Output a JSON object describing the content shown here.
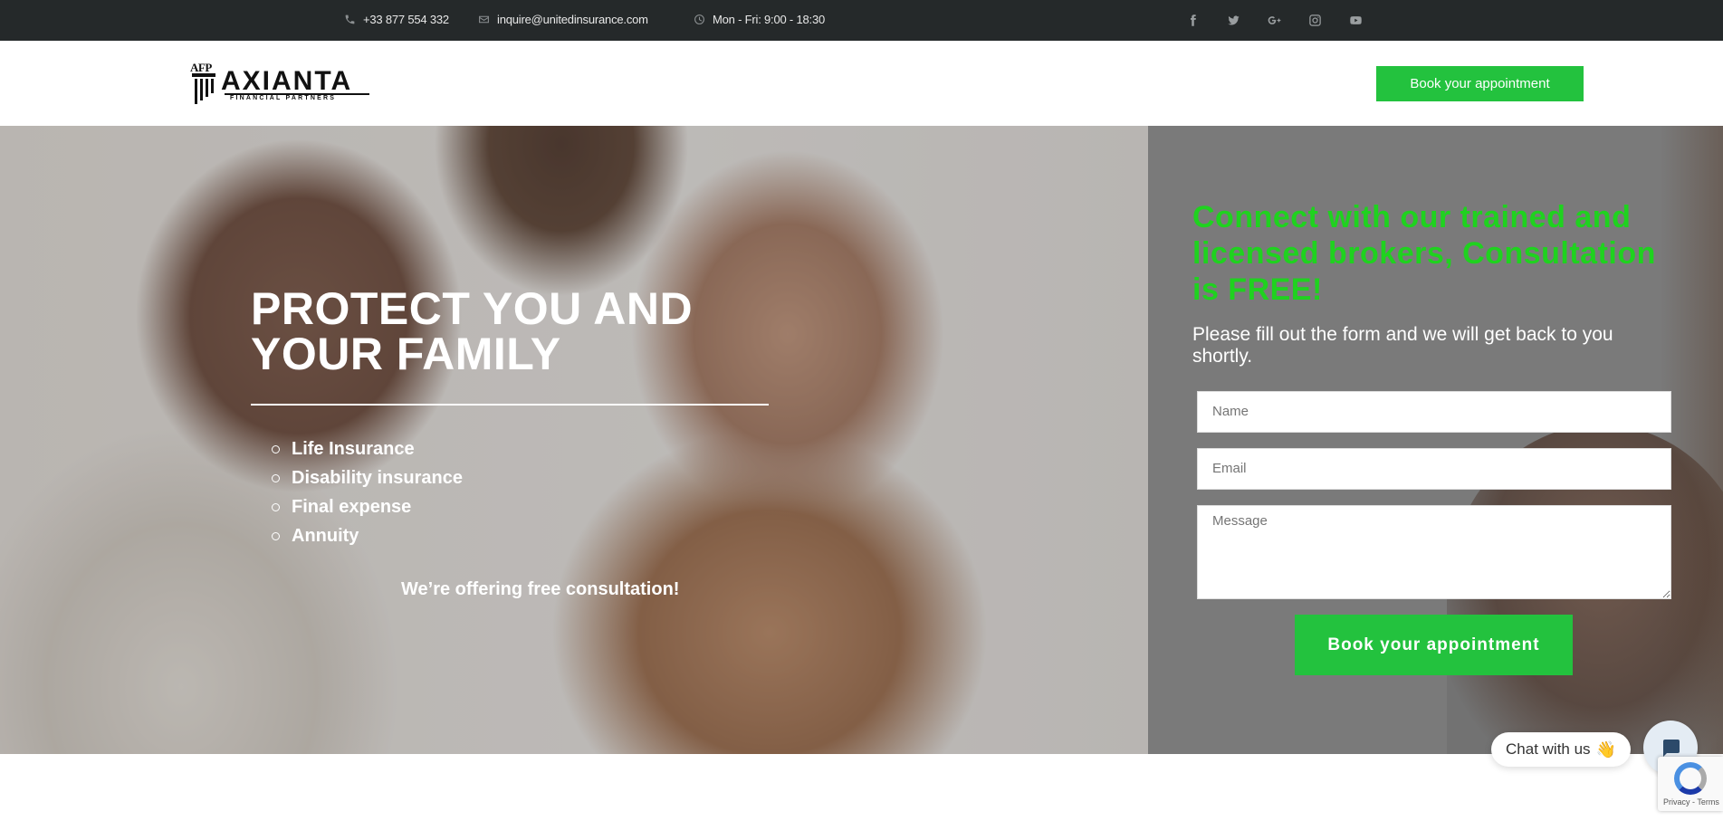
{
  "topbar": {
    "phone": "+33 877 554 332",
    "email": "inquire@unitedinsurance.com",
    "hours": "Mon - Fri: 9:00 - 18:30",
    "social": [
      "facebook",
      "twitter",
      "google-plus",
      "instagram",
      "youtube"
    ]
  },
  "header": {
    "logo_mark": "AFP",
    "logo_name": "AXIANTA",
    "logo_sub": "FINANCIAL PARTNERS",
    "cta": "Book your appointment"
  },
  "hero": {
    "headline_line1": "PROTECT YOU AND",
    "headline_line2": "YOUR FAMILY",
    "services": [
      "Life Insurance",
      "Disability insurance",
      "Final expense",
      "Annuity"
    ],
    "offer": "We’re offering free consultation!"
  },
  "form": {
    "heading": "Connect with our trained and licensed brokers, Consultation is FREE!",
    "intro": "Please fill out the form and we will get back to you shortly.",
    "name_placeholder": "Name",
    "email_placeholder": "Email",
    "message_placeholder": "Message",
    "submit": "Book your appointment"
  },
  "chat": {
    "label": "Chat with us",
    "emoji": "👋"
  },
  "recaptcha": {
    "text": "Privacy - Terms"
  },
  "colors": {
    "accent_green": "#23c23e",
    "heading_green": "#1fd21f",
    "topbar_bg": "#25292a"
  }
}
